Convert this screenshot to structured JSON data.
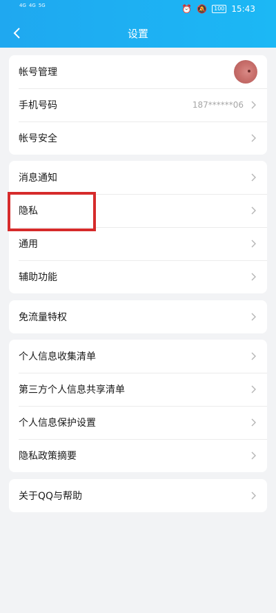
{
  "status_bar": {
    "signal_left": [
      "4G",
      "4G"
    ],
    "signal_right": "5G",
    "battery": "100",
    "time": "15:43",
    "icons": [
      "alarm-icon",
      "mute-icon",
      "battery-icon"
    ]
  },
  "nav": {
    "title": "设置",
    "back_icon": "back-arrow-icon"
  },
  "groups": {
    "account": {
      "items": [
        {
          "label": "帐号管理",
          "trailing": "avatar"
        },
        {
          "label": "手机号码",
          "value": "187******06"
        },
        {
          "label": "帐号安全"
        }
      ]
    },
    "general": {
      "items": [
        {
          "label": "消息通知"
        },
        {
          "label": "隐私"
        },
        {
          "label": "通用"
        },
        {
          "label": "辅助功能"
        }
      ]
    },
    "traffic": {
      "items": [
        {
          "label": "免流量特权"
        }
      ]
    },
    "info": {
      "items": [
        {
          "label": "个人信息收集清单"
        },
        {
          "label": "第三方个人信息共享清单"
        },
        {
          "label": "个人信息保护设置"
        },
        {
          "label": "隐私政策摘要"
        }
      ]
    },
    "about": {
      "items": [
        {
          "label": "关于QQ与帮助"
        }
      ]
    }
  },
  "colors": {
    "header": "#1fa8f0",
    "highlight": "#d62b2b",
    "background": "#f2f3f5"
  }
}
